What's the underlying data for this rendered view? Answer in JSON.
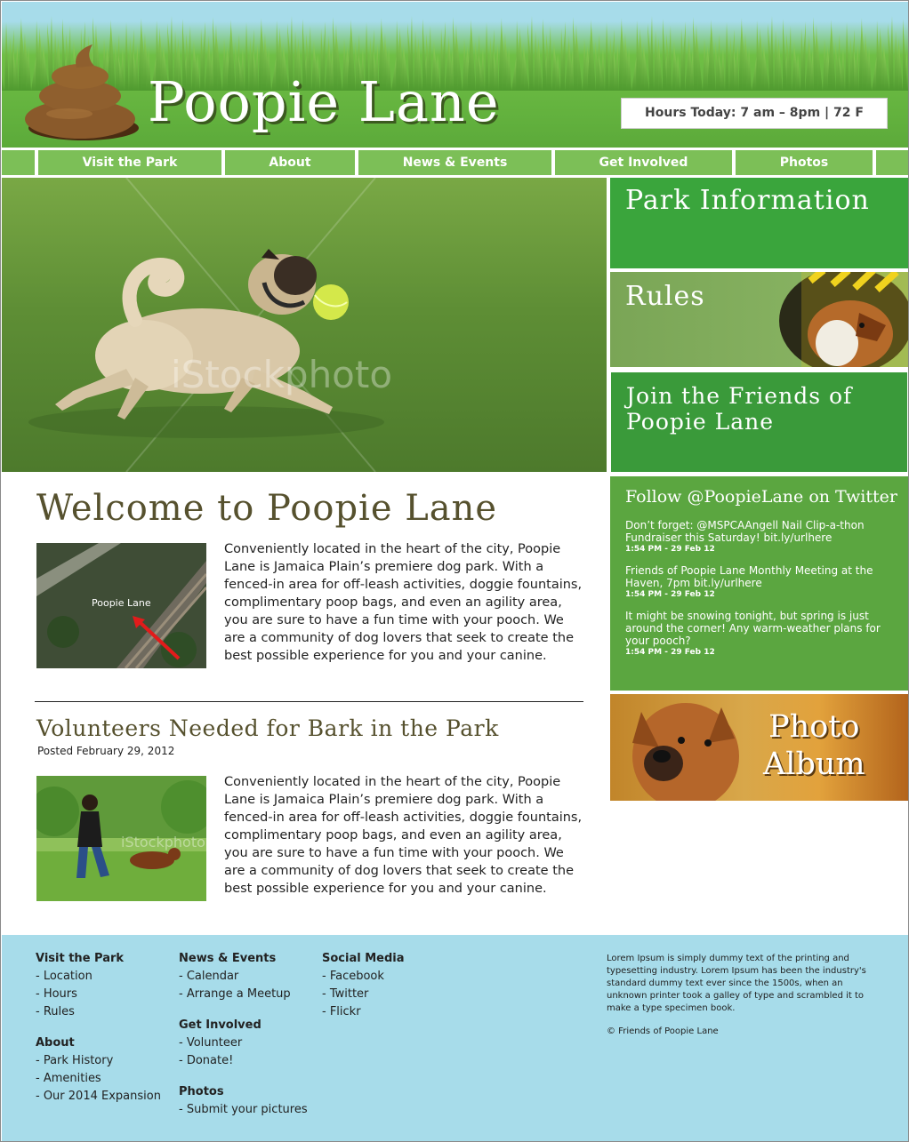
{
  "header": {
    "title": "Poopie Lane",
    "hours": "Hours Today: 7 am – 8pm | 72 F"
  },
  "nav": {
    "items": [
      "Visit the Park",
      "About",
      "News & Events",
      "Get Involved",
      "Photos"
    ]
  },
  "sidebar": {
    "park_info": "Park Information",
    "rules": "Rules",
    "join_line1": "Join the Friends of",
    "join_line2": "Poopie Lane",
    "twitter_heading": "Follow @PoopieLane on Twitter",
    "tweets": [
      {
        "text": "Don’t forget: @MSPCAAngell Nail Clip-a-thon Fundraiser this Saturday! bit.ly/urlhere",
        "time": "1:54 PM - 29 Feb 12"
      },
      {
        "text": "Friends of Poopie Lane Monthly Meeting at the Haven, 7pm bit.ly/urlhere",
        "time": "1:54 PM - 29 Feb 12"
      },
      {
        "text": "It might be snowing tonight, but spring is just around the corner! Any warm-weather plans for your pooch?",
        "time": "1:54 PM - 29 Feb 12"
      }
    ],
    "photo_album_line1": "Photo",
    "photo_album_line2": "Album"
  },
  "hero": {
    "watermark": "iStockphoto"
  },
  "main": {
    "welcome_title": "Welcome to Poopie Lane",
    "map_label": "Poopie Lane",
    "welcome_text": "Conveniently located in the heart of the city, Poopie Lane is Jamaica Plain’s premiere dog park. With a fenced-in area for off-leash activities, doggie fountains, complimentary poop bags, and even an agility area, you are sure to have a fun time with your pooch. We are a community of dog lovers that seek to create the best possible experience for you and your canine.",
    "post_title": "Volunteers Needed for Bark in the Park",
    "post_date": "Posted February 29, 2012",
    "post_text": "Conveniently located in the heart of the city, Poopie Lane is Jamaica Plain’s premiere dog park. With a fenced-in area for off-leash activities, doggie fountains, complimentary poop bags, and even an agility area, you are sure to have a fun time with your pooch. We are a community of dog lovers that seek to create the best possible experience for you and your canine."
  },
  "footer": {
    "col1": {
      "visit_heading": "Visit the Park",
      "visit_links": [
        "- Location",
        "- Hours",
        "- Rules"
      ],
      "about_heading": "About",
      "about_links": [
        "- Park History",
        "- Amenities",
        "- Our 2014 Expansion"
      ]
    },
    "col2": {
      "news_heading": "News & Events",
      "news_links": [
        "- Calendar",
        "- Arrange a Meetup"
      ],
      "involved_heading": "Get Involved",
      "involved_links": [
        "- Volunteer",
        "- Donate!"
      ],
      "photos_heading": "Photos",
      "photos_links": [
        "- Submit your pictures"
      ]
    },
    "col3": {
      "social_heading": "Social Media",
      "social_links": [
        "- Facebook",
        "- Twitter",
        "- Flickr"
      ]
    },
    "about_text": "Lorem Ipsum is simply dummy text of the printing and typesetting industry. Lorem Ipsum has been the industry's standard dummy text ever since the 1500s, when an unknown printer took a galley of type and scrambled it to make a type specimen book.",
    "copyright": "© Friends of Poopie Lane"
  },
  "colors": {
    "header_green": "#5caa3a",
    "nav_green": "#7cbf57",
    "tile_green": "#3aa53c",
    "twitter_green": "#5ba640",
    "footer_blue": "#a7dcea",
    "heading_brown": "#56512e"
  }
}
